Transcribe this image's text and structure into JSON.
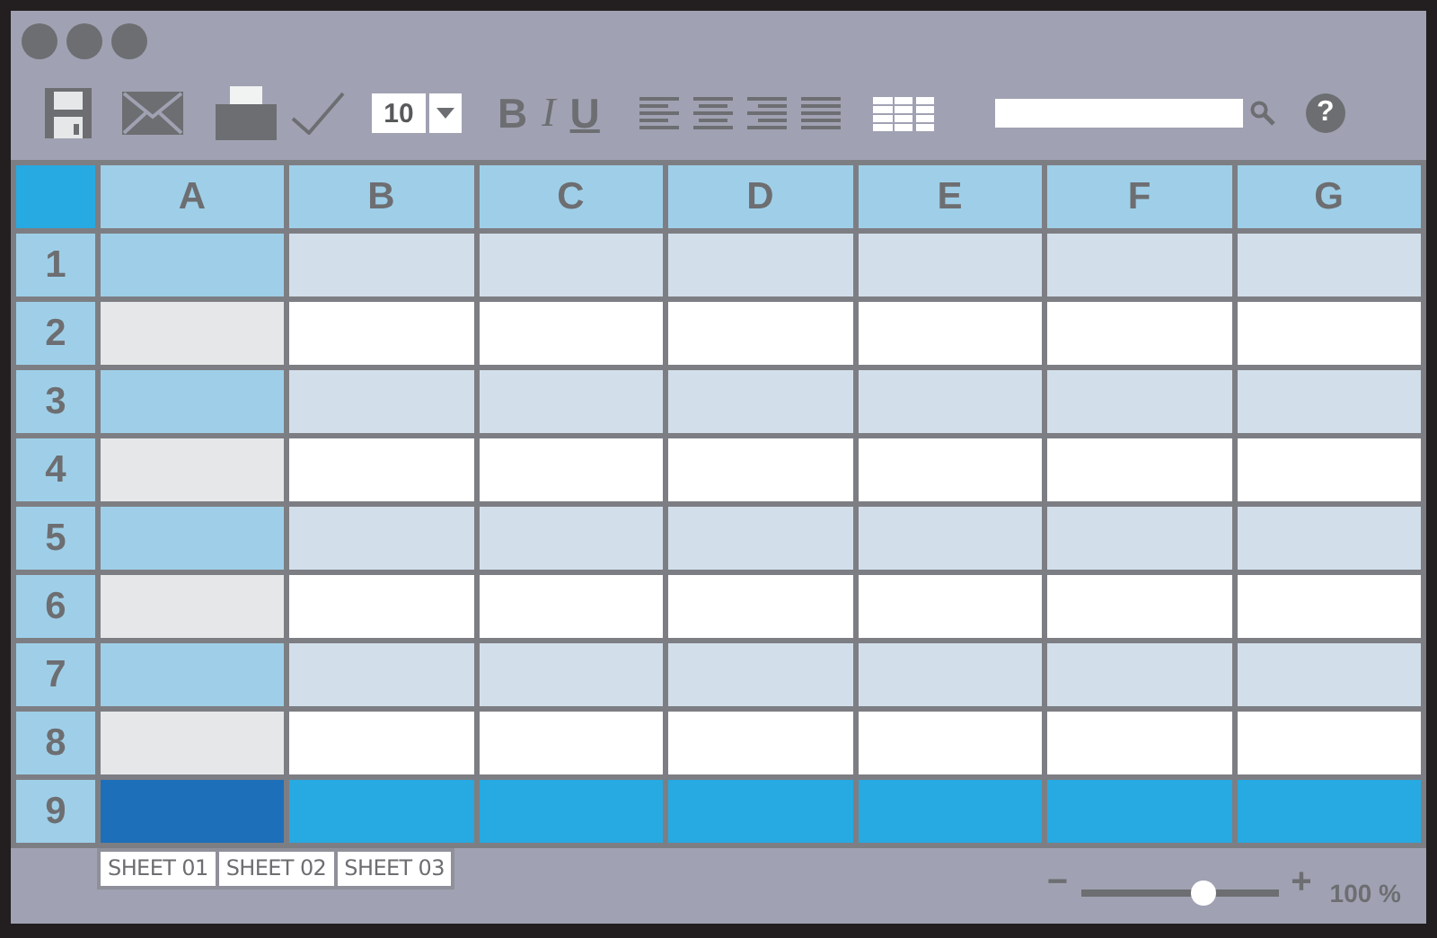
{
  "toolbar": {
    "font_size": "10",
    "format_buttons": [
      {
        "kind": "bold",
        "label": "B"
      },
      {
        "kind": "italic",
        "label": "I"
      },
      {
        "kind": "underline",
        "label": "U"
      }
    ],
    "help": "?"
  },
  "grid": {
    "columns": [
      {
        "label": "A",
        "selected": true
      },
      {
        "label": "B",
        "selected": false
      },
      {
        "label": "C",
        "selected": false
      },
      {
        "label": "D",
        "selected": false
      },
      {
        "label": "E",
        "selected": false
      },
      {
        "label": "F",
        "selected": false
      },
      {
        "label": "G",
        "selected": false
      }
    ],
    "rows": [
      {
        "label": "1",
        "selected": false
      },
      {
        "label": "2",
        "selected": false
      },
      {
        "label": "3",
        "selected": false
      },
      {
        "label": "4",
        "selected": false
      },
      {
        "label": "5",
        "selected": false
      },
      {
        "label": "6",
        "selected": false
      },
      {
        "label": "7",
        "selected": false
      },
      {
        "label": "8",
        "selected": false
      },
      {
        "label": "9",
        "selected": true
      }
    ]
  },
  "sheet_tabs": [
    {
      "label": "SHEET 01"
    },
    {
      "label": "SHEET 02"
    },
    {
      "label": "SHEET 03"
    }
  ],
  "zoom": {
    "minus": "−",
    "plus": "+",
    "level": 0.62,
    "reading": "100 %"
  }
}
